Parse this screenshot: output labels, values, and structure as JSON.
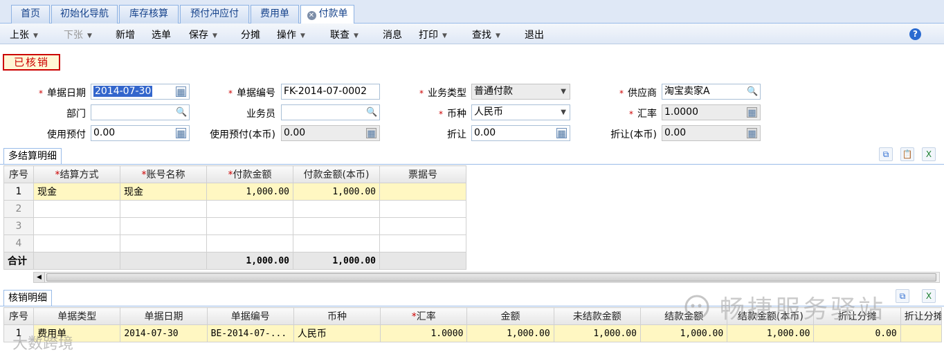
{
  "tabs": [
    "首页",
    "初始化导航",
    "库存核算",
    "预付冲应付",
    "费用单",
    "付款单"
  ],
  "toolbar": {
    "prev": "上张",
    "next": "下张",
    "new": "新增",
    "select": "选单",
    "save": "保存",
    "split": "分摊",
    "ops": "操作",
    "query": "联查",
    "msg": "消息",
    "print": "打印",
    "find": "查找",
    "exit": "退出",
    "help": "?"
  },
  "status": "已核销",
  "form": {
    "doc_date_label": "单据日期",
    "doc_date": "2014-07-30",
    "doc_no_label": "单据编号",
    "doc_no": "FK-2014-07-0002",
    "biz_type_label": "业务类型",
    "biz_type": "普通付款",
    "supplier_label": "供应商",
    "supplier": "淘宝卖家A",
    "dept_label": "部门",
    "dept": "",
    "staff_label": "业务员",
    "staff": "",
    "currency_label": "币种",
    "currency": "人民币",
    "rate_label": "汇率",
    "rate": "1.0000",
    "prepay_label": "使用预付",
    "prepay": "0.00",
    "prepay_base_label": "使用预付(本币)",
    "prepay_base": "0.00",
    "discount_label": "折让",
    "discount": "0.00",
    "discount_base_label": "折让(本币)",
    "discount_base": "0.00"
  },
  "settle": {
    "title": "多结算明细",
    "headers": [
      "序号",
      "结算方式",
      "账号名称",
      "付款金额",
      "付款金额(本币)",
      "票据号"
    ],
    "rows": [
      {
        "no": "1",
        "method": "现金",
        "account": "现金",
        "amount": "1,000.00",
        "amount_base": "1,000.00",
        "bill": ""
      },
      {
        "no": "2",
        "method": "",
        "account": "",
        "amount": "",
        "amount_base": "",
        "bill": ""
      },
      {
        "no": "3",
        "method": "",
        "account": "",
        "amount": "",
        "amount_base": "",
        "bill": ""
      },
      {
        "no": "4",
        "method": "",
        "account": "",
        "amount": "",
        "amount_base": "",
        "bill": ""
      }
    ],
    "total_label": "合计",
    "total_amount": "1,000.00",
    "total_amount_base": "1,000.00"
  },
  "writeoff": {
    "title": "核销明细",
    "headers": [
      "序号",
      "单据类型",
      "单据日期",
      "单据编号",
      "币种",
      "汇率",
      "金额",
      "未结款金额",
      "结款金额",
      "结款金额(本币)",
      "折让分摊",
      "折让分摊"
    ],
    "rows": [
      {
        "no": "1",
        "type": "费用单",
        "date": "2014-07-30",
        "doc_no": "BE-2014-07-...",
        "currency": "人民币",
        "rate": "1.0000",
        "amount": "1,000.00",
        "unpaid": "1,000.00",
        "paid": "1,000.00",
        "paid_base": "1,000.00",
        "disc": "0.00",
        "disc2": ""
      }
    ]
  },
  "watermark": {
    "main": "畅捷服务驿站",
    "corner": "大数跨境"
  }
}
